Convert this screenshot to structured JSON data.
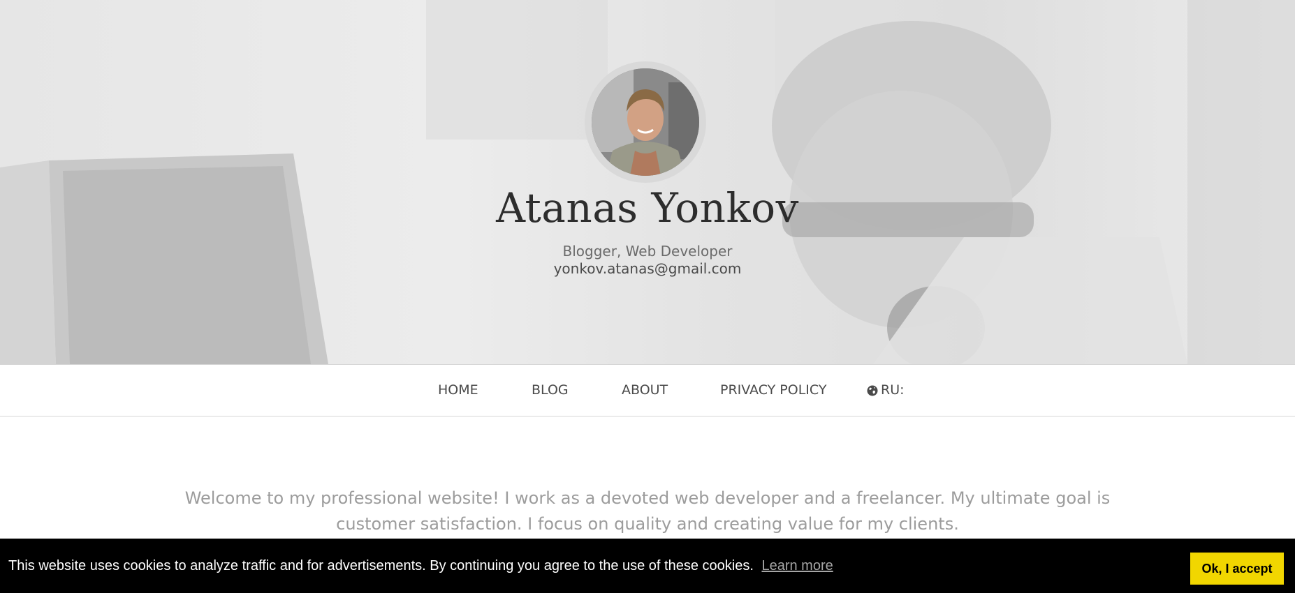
{
  "hero": {
    "name": "Atanas Yonkov",
    "role": "Blogger, Web Developer",
    "email": "yonkov.atanas@gmail.com"
  },
  "nav": {
    "items": [
      {
        "label": "HOME"
      },
      {
        "label": "BLOG"
      },
      {
        "label": "ABOUT"
      },
      {
        "label": "PRIVACY POLICY"
      }
    ],
    "language": {
      "icon": "globe-icon",
      "label": "RU:"
    }
  },
  "intro": {
    "text": "Welcome to my professional website! I work as a devoted web developer and a freelancer. My ultimate goal is customer satisfaction. I focus on quality and creating value for my clients."
  },
  "cookie": {
    "message": "This website uses cookies to analyze traffic and for advertisements. By continuing you agree to the use of these cookies.",
    "learn_more": "Learn more",
    "accept_label": "Ok, I accept"
  },
  "colors": {
    "cookie_bar_bg": "#000000",
    "accept_button_bg": "#f1d600",
    "intro_text": "#9c9c9c"
  }
}
